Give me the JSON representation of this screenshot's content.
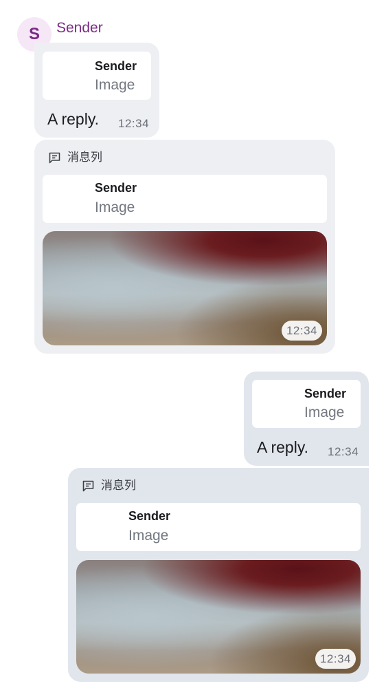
{
  "conversation": {
    "sender": {
      "name": "Sender",
      "avatar_letter": "S",
      "name_color": "#7b2a86"
    },
    "messages": [
      {
        "direction": "incoming",
        "reply_to": {
          "sender": "Sender",
          "type": "Image"
        },
        "text": "A reply.",
        "time": "12:34"
      },
      {
        "direction": "incoming",
        "thread_label": "消息列",
        "thread_icon": "thread-icon",
        "reply_to": {
          "sender": "Sender",
          "type": "Image"
        },
        "media": "image",
        "time": "12:34"
      },
      {
        "direction": "outgoing",
        "reply_to": {
          "sender": "Sender",
          "type": "Image"
        },
        "text": "A reply.",
        "time": "12:34"
      },
      {
        "direction": "outgoing",
        "thread_label": "消息列",
        "thread_icon": "thread-icon",
        "reply_to": {
          "sender": "Sender",
          "type": "Image"
        },
        "media": "image",
        "time": "12:34"
      }
    ]
  },
  "colors": {
    "incoming_bubble": "#eeeff3",
    "outgoing_bubble": "#e1e5ec",
    "avatar_background": "#f6e7f6"
  }
}
